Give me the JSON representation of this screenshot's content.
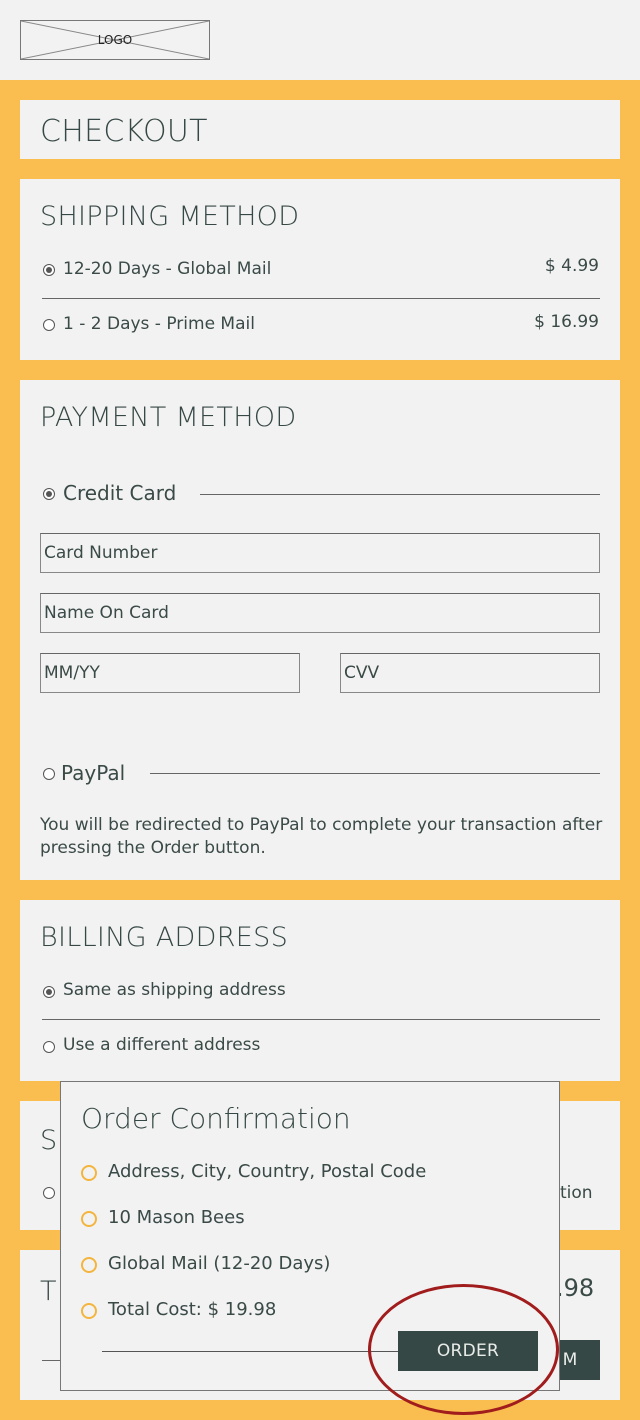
{
  "logo": {
    "text": "LOGO"
  },
  "checkout": {
    "title": "CHECKOUT"
  },
  "shipping": {
    "title": "SHIPPING METHOD",
    "options": [
      {
        "label": "12-20 Days - Global Mail",
        "price": "$ 4.99",
        "selected": true
      },
      {
        "label": "1 - 2 Days - Prime Mail",
        "price": "$ 16.99",
        "selected": false
      }
    ]
  },
  "payment": {
    "title": "PAYMENT METHOD",
    "credit_card": {
      "label": "Credit Card",
      "selected": true,
      "card_number_placeholder": "Card Number",
      "name_on_card_placeholder": "Name On Card",
      "expiry_placeholder": "MM/YY",
      "cvv_placeholder": "CVV"
    },
    "paypal": {
      "label": "PayPal",
      "selected": false,
      "note": "You will be redirected to PayPal to complete your transaction after pressing the Order button."
    }
  },
  "billing": {
    "title": "BILLING ADDRESS",
    "options": [
      {
        "label": "Same as shipping address",
        "selected": true
      },
      {
        "label": "Use a different address",
        "selected": false
      }
    ]
  },
  "obscured": {
    "section_title_fragment": "S",
    "option_fragment": "tion",
    "total_title_fragment": "T",
    "total_price_fragment": ".98",
    "button_fragment": "M"
  },
  "modal": {
    "title": "Order Confirmation",
    "items": [
      "Address, City, Country, Postal Code",
      "10 Mason Bees",
      "Global Mail (12-20 Days)",
      "Total Cost: $ 19.98"
    ],
    "order_button": "ORDER"
  },
  "colors": {
    "accent_yellow": "#f9be4f",
    "dark_green": "#364845",
    "annotation_red": "#a11c1c",
    "bullet_orange": "#f4b53f"
  }
}
